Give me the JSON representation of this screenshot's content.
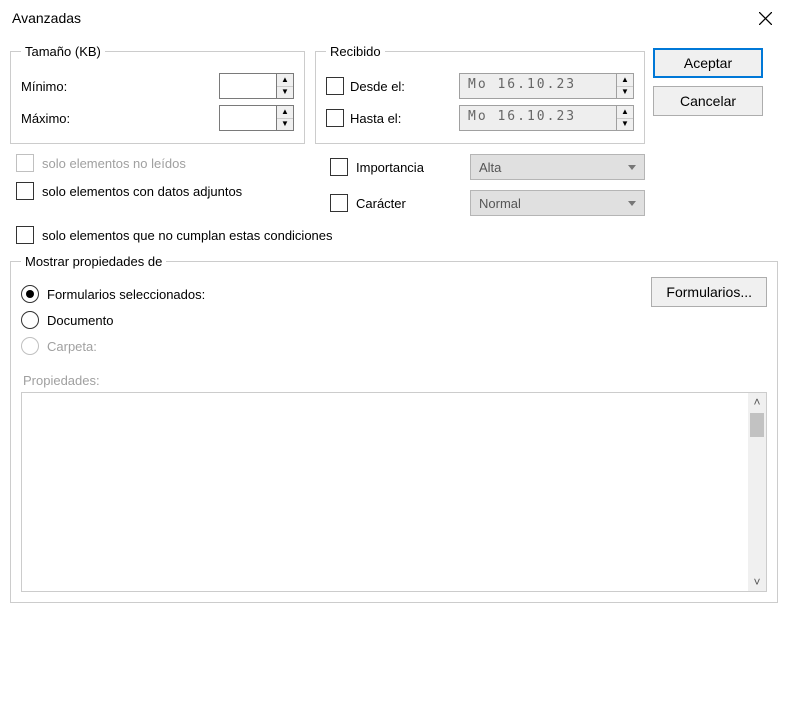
{
  "title": "Avanzadas",
  "buttons": {
    "accept": "Aceptar",
    "cancel": "Cancelar",
    "forms": "Formularios..."
  },
  "size": {
    "legend": "Tamaño (KB)",
    "min_label": "Mínimo:",
    "max_label": "Máximo:",
    "min_value": "",
    "max_value": ""
  },
  "received": {
    "legend": "Recibido",
    "from_label": "Desde el:",
    "to_label": "Hasta el:",
    "from_value": "Mo  16.10.23",
    "to_value": "Mo  16.10.23"
  },
  "checks": {
    "unread": "solo elementos no leídos",
    "attachments": "solo elementos con datos adjuntos",
    "not_match": "solo elementos que no cumplan estas condiciones"
  },
  "combos": {
    "importance_label": "Importancia",
    "importance_value": "Alta",
    "character_label": "Carácter",
    "character_value": "Normal"
  },
  "mostrar": {
    "legend": "Mostrar propiedades de",
    "forms_selected": "Formularios seleccionados:",
    "document": "Documento",
    "folder": "Carpeta:",
    "properties_label": "Propiedades:"
  }
}
